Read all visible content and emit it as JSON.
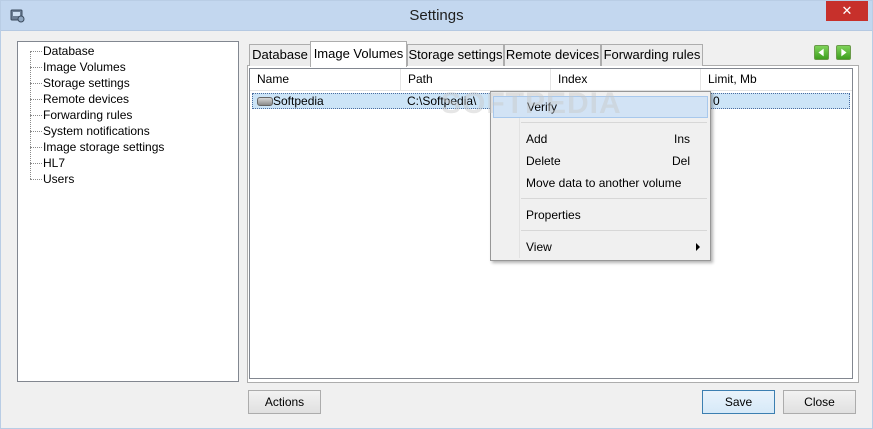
{
  "window": {
    "title": "Settings",
    "close_glyph": "✕"
  },
  "sidebar": {
    "items": [
      {
        "label": "Database"
      },
      {
        "label": "Image Volumes"
      },
      {
        "label": "Storage settings"
      },
      {
        "label": "Remote devices"
      },
      {
        "label": "Forwarding rules"
      },
      {
        "label": "System notifications"
      },
      {
        "label": "Image storage settings"
      },
      {
        "label": "HL7"
      },
      {
        "label": "Users"
      }
    ]
  },
  "tabs": [
    {
      "label": "Database"
    },
    {
      "label": "Image Volumes",
      "active": true
    },
    {
      "label": "Storage settings"
    },
    {
      "label": "Remote devices"
    },
    {
      "label": "Forwarding rules"
    }
  ],
  "table": {
    "columns": [
      "Name",
      "Path",
      "Index",
      "Limit, Mb"
    ],
    "rows": [
      {
        "name": "Softpedia",
        "path": "C:\\Softpedia\\",
        "limit": "0"
      }
    ]
  },
  "context_menu": {
    "items": [
      {
        "label": "Verify",
        "shortcut": ""
      },
      {
        "label": "Add",
        "shortcut": "Ins"
      },
      {
        "label": "Delete",
        "shortcut": "Del"
      },
      {
        "label": "Move data to another volume",
        "shortcut": ""
      },
      {
        "label": "Properties",
        "shortcut": ""
      },
      {
        "label": "View",
        "shortcut": ""
      }
    ]
  },
  "watermark": "SOFTPEDIA",
  "buttons": {
    "actions": "Actions",
    "save": "Save",
    "close": "Close"
  },
  "colors": {
    "titlebar": "#c3d7ef",
    "close": "#c7302b",
    "selection": "#cce4f7",
    "nav_arrow": "#3f9f1f"
  }
}
